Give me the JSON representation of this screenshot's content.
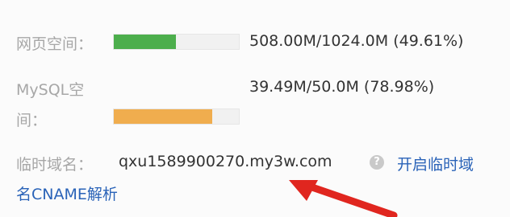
{
  "web_space": {
    "label": "网页空间：",
    "value": "508.00M/1024.0M (49.61%)",
    "fill_fraction": 0.4961,
    "fill_color": "#4cae4c"
  },
  "mysql_space": {
    "label_line1": "MySQL空",
    "label_line2": "间：",
    "value": "39.49M/50.0M (78.98%)",
    "fill_fraction": 0.7898,
    "fill_color": "#f0ad4e"
  },
  "temp_domain": {
    "label": "临时域名：",
    "value": "qxu1589900270.my3w.com",
    "help_icon": "?",
    "link_line1": "开启临时域",
    "link_line2": "名CNAME解析"
  },
  "annotation": {
    "arrow_color": "#e0261f"
  }
}
